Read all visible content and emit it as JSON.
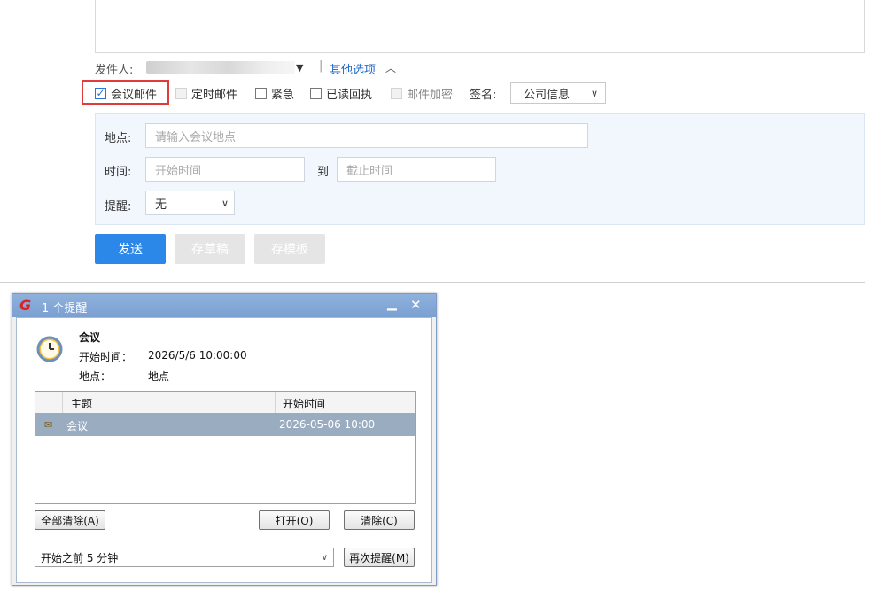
{
  "compose": {
    "sender_label": "发件人:",
    "more_options_label": "其他选项",
    "options": {
      "meeting_mail": "会议邮件",
      "scheduled_mail": "定时邮件",
      "urgent": "紧急",
      "read_receipt": "已读回执",
      "encrypt": "邮件加密"
    },
    "signature_label": "签名:",
    "signature_value": "公司信息",
    "meeting": {
      "location_label": "地点:",
      "location_placeholder": "请输入会议地点",
      "time_label": "时间:",
      "start_placeholder": "开始时间",
      "to_label": "到",
      "end_placeholder": "截止时间",
      "remind_label": "提醒:",
      "remind_value": "无"
    },
    "buttons": {
      "send": "发送",
      "save_draft": "存草稿",
      "save_template": "存模板"
    }
  },
  "reminder_dialog": {
    "title": "1 个提醒",
    "subject": "会议",
    "start_time_label": "开始时间：",
    "start_time_value": "2026/5/6 10:00:00",
    "location_label": "地点：",
    "location_value": "地点",
    "columns": [
      "主题",
      "开始时间"
    ],
    "rows": [
      {
        "subject": "会议",
        "start": "2026-05-06 10:00"
      }
    ],
    "buttons": {
      "clear_all": "全部清除(A)",
      "open": "打开(O)",
      "clear": "清除(C)",
      "snooze": "再次提醒(M)"
    },
    "snooze_value": "开始之前 5 分钟"
  },
  "colors": {
    "accent": "#2b87e8",
    "link": "#1c64c6",
    "highlight": "#e03a3a"
  }
}
